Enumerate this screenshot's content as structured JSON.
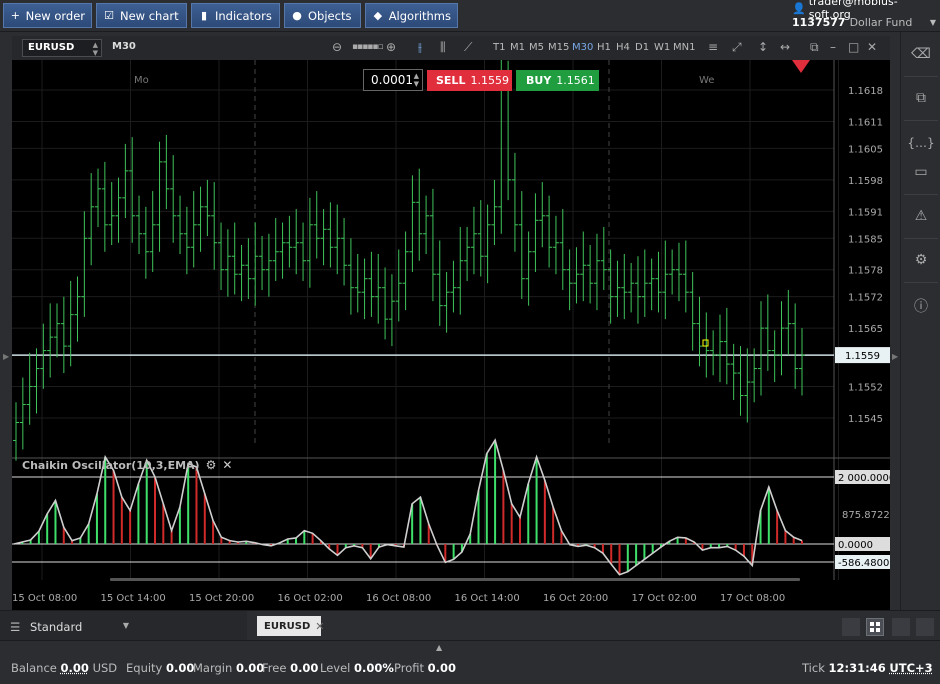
{
  "toolbar": {
    "buttons": [
      {
        "label": "New order",
        "icon": "plus-icon"
      },
      {
        "label": "New chart",
        "icon": "chart-check-icon"
      },
      {
        "label": "Indicators",
        "icon": "bars-icon"
      },
      {
        "label": "Objects",
        "icon": "shapes-icon"
      },
      {
        "label": "Algorithms",
        "icon": "diamond-icon"
      }
    ]
  },
  "account": {
    "user": "trader@mobius-soft.org",
    "fund_id": "1137577",
    "fund_name": "Dollar Fund"
  },
  "chart_header": {
    "symbol": "EURUSD",
    "timeframe": "M30",
    "timeframes": [
      "T1",
      "M1",
      "M5",
      "M15",
      "M30",
      "H1",
      "H4",
      "D1",
      "W1",
      "MN1"
    ],
    "active_timeframe": "M30"
  },
  "trade_panel": {
    "lot": "0.0001",
    "sell_label": "SELL",
    "sell_price": "1.1559",
    "buy_label": "BUY",
    "buy_price": "1.1561"
  },
  "chart_data": [
    {
      "type": "ohlc",
      "symbol": "EURUSD",
      "day_labels": [
        "Mo",
        "We"
      ],
      "y_ticks": [
        "1.1618",
        "1.1611",
        "1.1605",
        "1.1598",
        "1.1591",
        "1.1585",
        "1.1578",
        "1.1572",
        "1.1565",
        "1.1559",
        "1.1552",
        "1.1545"
      ],
      "ylim": [
        1.154,
        1.1625
      ],
      "current_price": "1.1559",
      "x_ticks": [
        "15 Oct 08:00",
        "15 Oct 14:00",
        "15 Oct 20:00",
        "16 Oct 02:00",
        "16 Oct 08:00",
        "16 Oct 14:00",
        "16 Oct 20:00",
        "17 Oct 02:00",
        "17 Oct 08:00"
      ],
      "closes": [
        1.1544,
        1.1548,
        1.1552,
        1.1556,
        1.156,
        1.1563,
        1.1566,
        1.1561,
        1.1568,
        1.1572,
        1.1585,
        1.1592,
        1.1596,
        1.1588,
        1.159,
        1.1594,
        1.16,
        1.159,
        1.1586,
        1.1582,
        1.1588,
        1.1602,
        1.1596,
        1.159,
        1.1586,
        1.1583,
        1.1588,
        1.1592,
        1.159,
        1.1584,
        1.1578,
        1.1581,
        1.1577,
        1.1579,
        1.1576,
        1.1581,
        1.1578,
        1.158,
        1.1582,
        1.1584,
        1.1583,
        1.1584,
        1.158,
        1.1588,
        1.1585,
        1.1587,
        1.1583,
        1.1585,
        1.1579,
        1.1574,
        1.1573,
        1.1576,
        1.1572,
        1.1574,
        1.1567,
        1.1571,
        1.1575,
        1.1582,
        1.1593,
        1.1586,
        1.159,
        1.1577,
        1.157,
        1.1573,
        1.1574,
        1.158,
        1.1583,
        1.1586,
        1.1581,
        1.1588,
        1.1592,
        1.162,
        1.1598,
        1.1588,
        1.1576,
        1.1582,
        1.1589,
        1.159,
        1.1583,
        1.1584,
        1.1578,
        1.1575,
        1.1577,
        1.1579,
        1.1575,
        1.158,
        1.1578,
        1.1572,
        1.1574,
        1.1573,
        1.1575,
        1.1572,
        1.1575,
        1.1576,
        1.1573,
        1.1577,
        1.1578,
        1.1577,
        1.1573,
        1.1566,
        1.1561,
        1.156,
        1.1559,
        1.1562,
        1.1557,
        1.1555,
        1.155,
        1.1553,
        1.1556,
        1.1565,
        1.156,
        1.1559,
        1.1565,
        1.1566,
        1.1556,
        1.1559
      ]
    },
    {
      "type": "histogram-line",
      "title": "Chaikin Oscillator(10,3,EMA)",
      "y_ticks": [
        "2 000.0000",
        "875.8722",
        "0.0000",
        "-586.4800"
      ],
      "values": [
        0,
        60,
        120,
        380,
        900,
        1300,
        500,
        100,
        180,
        600,
        1500,
        2600,
        2200,
        1400,
        1000,
        1800,
        2500,
        2000,
        1200,
        400,
        1100,
        2400,
        2300,
        1500,
        700,
        200,
        100,
        60,
        80,
        40,
        -20,
        -60,
        30,
        150,
        180,
        400,
        320,
        100,
        -160,
        -370,
        -120,
        -60,
        -120,
        -480,
        -100,
        -20,
        -60,
        -100,
        1200,
        1400,
        600,
        -40,
        -600,
        -500,
        -260,
        300,
        1600,
        2700,
        3100,
        2200,
        1200,
        800,
        1800,
        2600,
        1900,
        1100,
        400,
        -20,
        -80,
        -40,
        -120,
        -300,
        -660,
        -1000,
        -900,
        -700,
        -500,
        -300,
        -100,
        80,
        200,
        180,
        60,
        -200,
        -120,
        -120,
        -80,
        -200,
        -400,
        -700,
        1000,
        1700,
        1000,
        400,
        200,
        100
      ]
    }
  ],
  "tabbar": {
    "layout": "Standard",
    "chart_tab": "EURUSD"
  },
  "statusbar": {
    "balance_label": "Balance",
    "balance": "0.00",
    "currency": "USD",
    "equity_label": "Equity",
    "equity": "0.00",
    "margin_label": "Margin",
    "margin": "0.00",
    "free_label": "Free",
    "free": "0.00",
    "level_label": "Level",
    "level": "0.00%",
    "profit_label": "Profit",
    "profit": "0.00",
    "tick_label": "Tick",
    "time": "12:31:46",
    "timezone": "UTC+3"
  }
}
